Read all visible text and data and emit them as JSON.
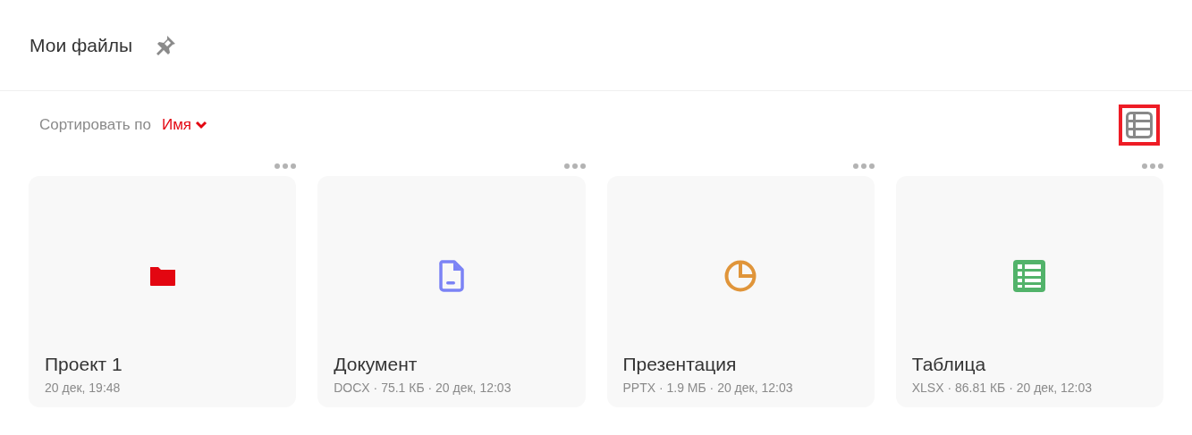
{
  "header": {
    "title": "Мои файлы"
  },
  "toolbar": {
    "sort_label": "Сортировать по",
    "sort_value": "Имя",
    "view_toggle": {
      "highlighted": true
    }
  },
  "files": [
    {
      "kind": "folder",
      "name": "Проект 1",
      "meta": "20 дек, 19:48",
      "color": "#e30611"
    },
    {
      "kind": "document",
      "name": "Документ",
      "meta": "DOCX · 75.1 КБ · 20 дек, 12:03",
      "color": "#7b83f5"
    },
    {
      "kind": "presentation",
      "name": "Презентация",
      "meta": "PPTX · 1.9 МБ · 20 дек, 12:03",
      "color": "#e0953a"
    },
    {
      "kind": "spreadsheet",
      "name": "Таблица",
      "meta": "XLSX · 86.81 КБ · 20 дек, 12:03",
      "color": "#52b36a"
    }
  ]
}
